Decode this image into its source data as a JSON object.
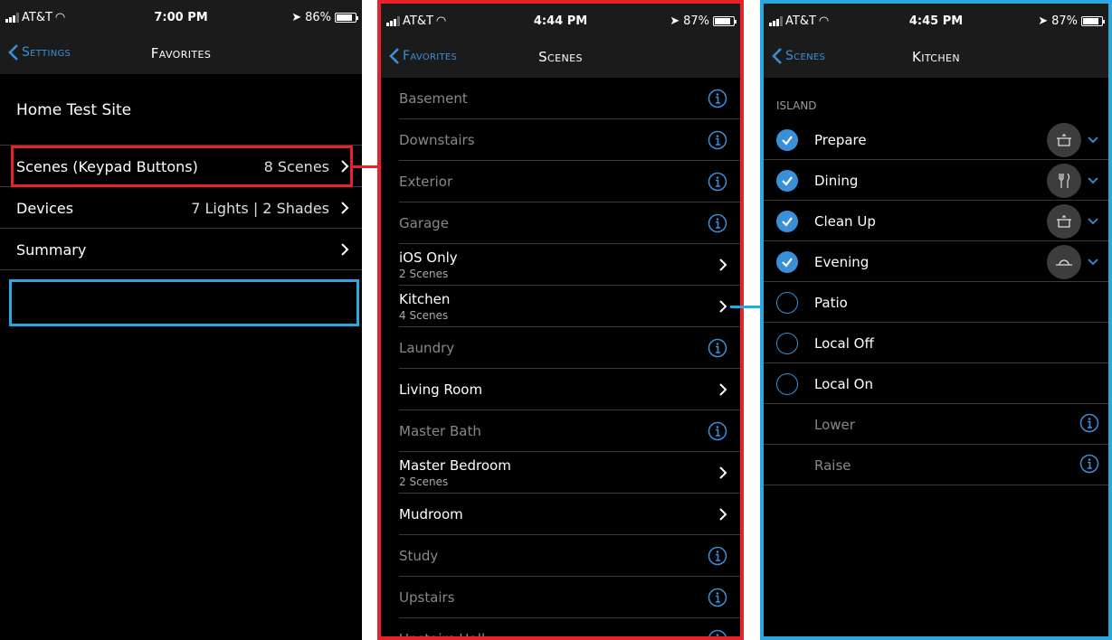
{
  "phone1": {
    "status": {
      "carrier": "AT&T",
      "time": "7:00 PM",
      "battery": "86%"
    },
    "nav": {
      "back": "Settings",
      "title": "Favorites"
    },
    "site": "Home Test Site",
    "rows": [
      {
        "label": "Scenes (Keypad Buttons)",
        "value": "8 Scenes"
      },
      {
        "label": "Devices",
        "value": "7 Lights | 2 Shades"
      },
      {
        "label": "Summary",
        "value": ""
      }
    ]
  },
  "phone2": {
    "status": {
      "carrier": "AT&T",
      "time": "4:44 PM",
      "battery": "87%"
    },
    "nav": {
      "back": "Favorites",
      "title": "Scenes"
    },
    "rows": [
      {
        "label": "Basement",
        "sub": "",
        "accessory": "info"
      },
      {
        "label": "Downstairs",
        "sub": "",
        "accessory": "info"
      },
      {
        "label": "Exterior",
        "sub": "",
        "accessory": "info"
      },
      {
        "label": "Garage",
        "sub": "",
        "accessory": "info"
      },
      {
        "label": "iOS Only",
        "sub": "2 Scenes",
        "accessory": "chevron"
      },
      {
        "label": "Kitchen",
        "sub": "4 Scenes",
        "accessory": "chevron"
      },
      {
        "label": "Laundry",
        "sub": "",
        "accessory": "info"
      },
      {
        "label": "Living Room",
        "sub": "",
        "accessory": "chevron"
      },
      {
        "label": "Master Bath",
        "sub": "",
        "accessory": "info"
      },
      {
        "label": "Master Bedroom",
        "sub": "2 Scenes",
        "accessory": "chevron"
      },
      {
        "label": "Mudroom",
        "sub": "",
        "accessory": "chevron"
      },
      {
        "label": "Study",
        "sub": "",
        "accessory": "info"
      },
      {
        "label": "Upstairs",
        "sub": "",
        "accessory": "info"
      },
      {
        "label": "Upstairs Hall",
        "sub": "",
        "accessory": "info"
      }
    ]
  },
  "phone3": {
    "status": {
      "carrier": "AT&T",
      "time": "4:45 PM",
      "battery": "87%"
    },
    "nav": {
      "back": "Scenes",
      "title": "Kitchen"
    },
    "section": "ISLAND",
    "rows": [
      {
        "label": "Prepare",
        "state": "checked",
        "icon": "pot-icon"
      },
      {
        "label": "Dining",
        "state": "checked",
        "icon": "fork-knife-icon"
      },
      {
        "label": "Clean Up",
        "state": "checked",
        "icon": "pot-icon"
      },
      {
        "label": "Evening",
        "state": "checked",
        "icon": "sunset-icon"
      },
      {
        "label": "Patio",
        "state": "unchecked",
        "icon": ""
      },
      {
        "label": "Local Off",
        "state": "unchecked",
        "icon": ""
      },
      {
        "label": "Local On",
        "state": "unchecked",
        "icon": ""
      },
      {
        "label": "Lower",
        "state": "none",
        "icon": "info-icon"
      },
      {
        "label": "Raise",
        "state": "none",
        "icon": "info-icon"
      }
    ]
  },
  "colors": {
    "accent": "#3a8fd9",
    "highlight_red": "#e8212a",
    "highlight_blue": "#2aa7df",
    "background": "#000000"
  }
}
